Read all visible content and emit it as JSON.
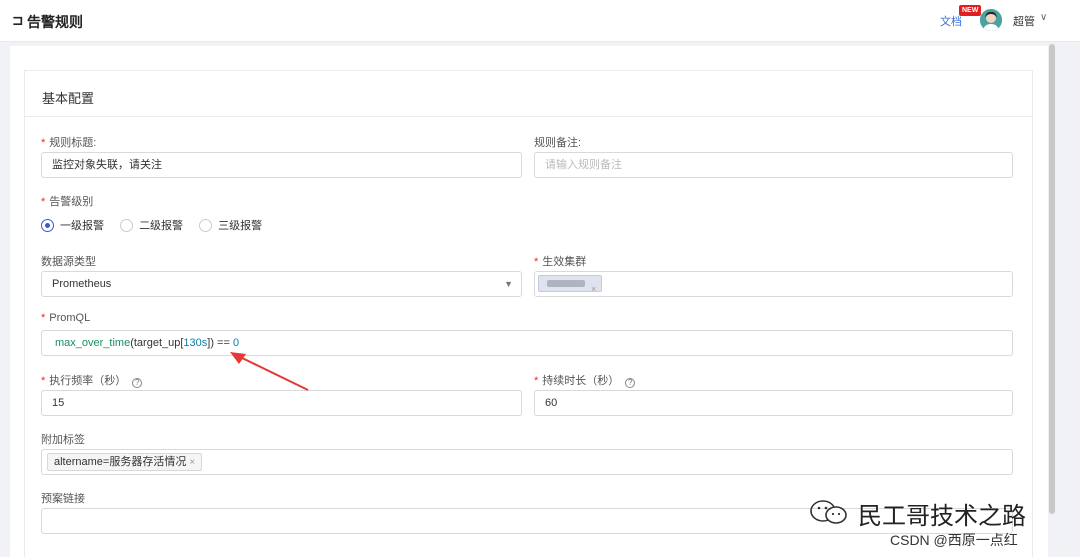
{
  "header": {
    "back_icon": "⊐",
    "title": "告警规则",
    "docs_label": "文档",
    "new_badge": "NEW",
    "user_name": "超管",
    "user_caret": "∨"
  },
  "card": {
    "title": "基本配置"
  },
  "form": {
    "rule_title": {
      "label": "规则标题:",
      "value": "监控对象失联，请关注"
    },
    "rule_note": {
      "label": "规则备注:",
      "placeholder": "请输入规则备注"
    },
    "alert_level": {
      "label": "告警级别",
      "options": [
        "一级报警",
        "二级报警",
        "三级报警"
      ],
      "selected": "一级报警"
    },
    "datasource_type": {
      "label": "数据源类型",
      "value": "Prometheus"
    },
    "cluster": {
      "label": "生效集群"
    },
    "promql": {
      "label": "PromQL",
      "fn": "max_over_time",
      "open": "(target_up[",
      "range": "130s",
      "close": "]) == ",
      "threshold": "0"
    },
    "interval": {
      "label": "执行频率（秒）",
      "value": "15"
    },
    "duration": {
      "label": "持续时长（秒）",
      "value": "60"
    },
    "extra_labels": {
      "label": "附加标签",
      "tags": [
        {
          "text": "altername=服务器存活情况"
        }
      ],
      "tag_close": "×"
    },
    "runbook": {
      "label": "预案链接",
      "value": ""
    }
  },
  "watermark": {
    "text": "民工哥技术之路",
    "sub": "CSDN @西原一点红"
  },
  "colors": {
    "accent": "#3a57d8",
    "required": "#f5222d",
    "arrow": "#e53935"
  }
}
